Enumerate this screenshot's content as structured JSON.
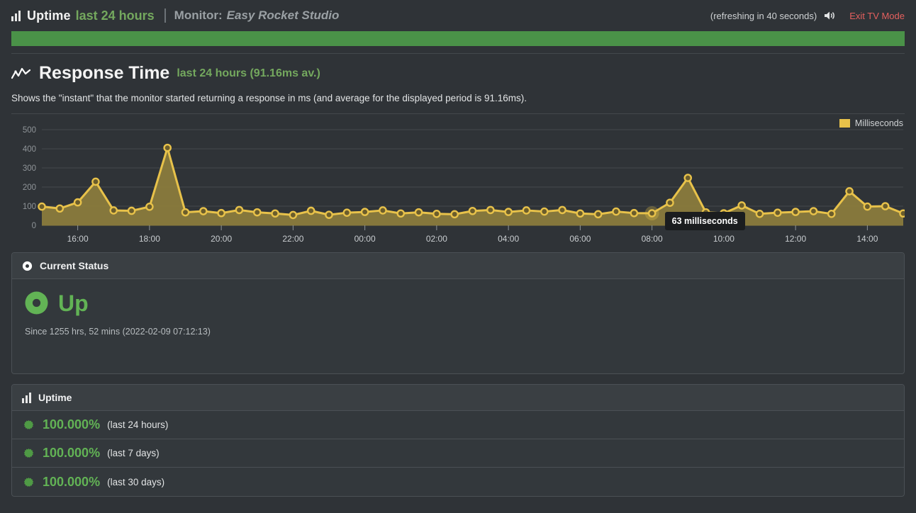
{
  "topbar": {
    "icon": "bar-chart-icon",
    "title": "Uptime",
    "subtitle": "last 24 hours",
    "monitor_label": "Monitor:",
    "monitor_name": "Easy Rocket Studio",
    "refresh_text": "(refreshing in 40 seconds)",
    "sound_icon": "speaker-icon",
    "exit_tv_mode": "Exit TV Mode"
  },
  "uptime_bar": {
    "color": "#4a9248",
    "label": "uptime-availability-bar"
  },
  "response_time": {
    "icon": "line-chart-icon",
    "title": "Response Time",
    "subtitle": "last 24 hours (91.16ms av.)",
    "description": "Shows the \"instant\" that the monitor started returning a response in ms (and average for the displayed period is 91.16ms).",
    "legend_label": "Milliseconds",
    "legend_color": "#e8c24a",
    "tooltip": "63 milliseconds"
  },
  "current_status": {
    "header": "Current Status",
    "header_icon": "target-icon",
    "status_icon": "circle-dot-icon",
    "status": "Up",
    "status_color": "#62b355",
    "since": "Since 1255 hrs, 52 mins (2022-02-09 07:12:13)"
  },
  "uptime_panel": {
    "header": "Uptime",
    "header_icon": "bar-chart-icon",
    "rows": [
      {
        "icon": "starburst-icon",
        "value": "100.000%",
        "period": "(last 24 hours)"
      },
      {
        "icon": "starburst-icon",
        "value": "100.000%",
        "period": "(last 7 days)"
      },
      {
        "icon": "starburst-icon",
        "value": "100.000%",
        "period": "(last 30 days)"
      }
    ]
  },
  "chart_data": {
    "type": "area",
    "title": "Response Time",
    "xlabel": "",
    "ylabel": "Milliseconds",
    "ylim": [
      0,
      500
    ],
    "yticks": [
      0,
      100,
      200,
      300,
      400,
      500
    ],
    "grid": true,
    "legend_position": "top-right",
    "series_name": "Milliseconds",
    "color": "#e8c24a",
    "fill_color": "#8a7b3c",
    "xticks": [
      "16:00",
      "18:00",
      "20:00",
      "22:00",
      "00:00",
      "02:00",
      "04:00",
      "06:00",
      "08:00",
      "10:00",
      "12:00",
      "14:00"
    ],
    "x": [
      "15:00",
      "15:30",
      "16:00",
      "16:30",
      "17:00",
      "17:30",
      "18:00",
      "18:30",
      "19:00",
      "19:30",
      "20:00",
      "20:30",
      "21:00",
      "21:30",
      "22:00",
      "22:30",
      "23:00",
      "23:30",
      "00:00",
      "00:30",
      "01:00",
      "01:30",
      "02:00",
      "02:30",
      "03:00",
      "03:30",
      "04:00",
      "04:30",
      "05:00",
      "05:30",
      "06:00",
      "06:30",
      "07:00",
      "07:30",
      "08:00",
      "08:30",
      "09:00",
      "09:30",
      "10:00",
      "10:30",
      "11:00",
      "11:30",
      "12:00",
      "12:30",
      "13:00",
      "13:30",
      "14:00",
      "14:30",
      "15:00"
    ],
    "values": [
      98,
      88,
      120,
      228,
      78,
      76,
      97,
      405,
      68,
      74,
      64,
      80,
      68,
      62,
      54,
      76,
      55,
      66,
      70,
      78,
      62,
      68,
      60,
      58,
      75,
      80,
      70,
      78,
      72,
      80,
      62,
      58,
      72,
      64,
      63,
      118,
      248,
      68,
      63,
      104,
      60,
      66,
      70,
      74,
      60,
      178,
      98,
      100,
      62
    ],
    "highlighted_point": {
      "x": "08:00",
      "value": 63,
      "label": "63 milliseconds"
    }
  }
}
